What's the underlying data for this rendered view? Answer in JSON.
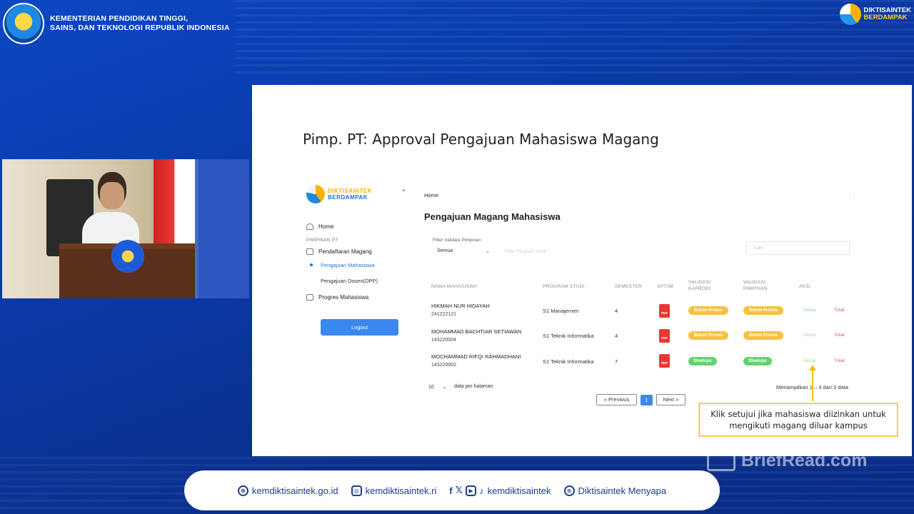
{
  "header": {
    "ministry_line1": "KEMENTERIAN PENDIDIKAN TINGGI,",
    "ministry_line2": "SAINS, DAN TEKNOLOGI REPUBLIK INDONESIA",
    "brand_line1": "DIKTISAINTEK",
    "brand_line2": "BERDAMPAK"
  },
  "slide": {
    "title": "Pimp. PT: Approval Pengajuan Mahasiswa Magang"
  },
  "app": {
    "logo_line1": "DIKTISAINTEK",
    "logo_line2": "BERDAMPAK",
    "collapse_icon": "+",
    "sidebar": {
      "home": "Home",
      "section": "PIMPINAN PT",
      "pendaftaran": "Pendaftaran Magang",
      "pengajuan_mahasiswa": "Pengajuan Mahasiswa",
      "pengajuan_dosen": "Pengajuan Dosen(DPP)",
      "progres": "Progres Mahasiswa",
      "logout": "Logout"
    },
    "breadcrumb": "Home",
    "page_title": "Pengajuan Magang Mahasiswa",
    "filter": {
      "label": "Filter Validasi Pimpinan",
      "selected": "Semua",
      "program_placeholder": "Filter Program Studi",
      "search_placeholder": "Cari"
    },
    "table": {
      "headers": {
        "nama": "NAMA MAHASISWA",
        "program": "PROGRAM STUDI",
        "semester": "SEMESTER",
        "sptjm": "SPTJM",
        "kaprodi_1": "VALIDASI",
        "kaprodi_2": "KAPRODI",
        "pimpinan_1": "VALIDASI",
        "pimpinan_2": "PIMPINAN",
        "aksi": "AKSI"
      },
      "rows": [
        {
          "name": "HIKMAH NUR HIDAYAH",
          "nim": "241222121",
          "program": "S1 Manajemen",
          "semester": "4",
          "pdf": "PDF",
          "kaprodi": "Belum Proses",
          "pimpinan": "Belum Proses",
          "approve": "Setuju",
          "reject": "Tolak"
        },
        {
          "name": "MOHAMMAD BACHTIAR SETIAWAN",
          "nim": "143220004",
          "program": "S1 Teknik Informatika",
          "semester": "4",
          "pdf": "PDF",
          "kaprodi": "Belum Proses",
          "pimpinan": "Belum Proses",
          "approve": "Setuju",
          "reject": "Tolak"
        },
        {
          "name": "MOCHAMMAD RIFQI RAHMADHANI",
          "nim": "143220002",
          "program": "S1 Teknik Informatika",
          "semester": "7",
          "pdf": "PDF",
          "kaprodi": "Disetujui",
          "pimpinan": "Disetujui",
          "approve": "Setuju",
          "reject": "Tolak"
        }
      ]
    },
    "pagination": {
      "per_page_value": "10",
      "per_page_label": "data per halaman",
      "info": "Menampilkan 1 – 3 dari 3 data",
      "prev": "« Previous",
      "current": "1",
      "next": "Next »"
    },
    "tooltip_line1": "Klik setujui jika mahasiswa diizinkan untuk",
    "tooltip_line2": "mengikuti magang diluar kampus"
  },
  "watermark": "BriefRead.com",
  "footer": {
    "website": "kemdiktisaintek.go.id",
    "instagram": "kemdiktisaintek.ri",
    "social": "kemdiktisaintek",
    "spotify": "Diktisaintek Menyapa"
  }
}
